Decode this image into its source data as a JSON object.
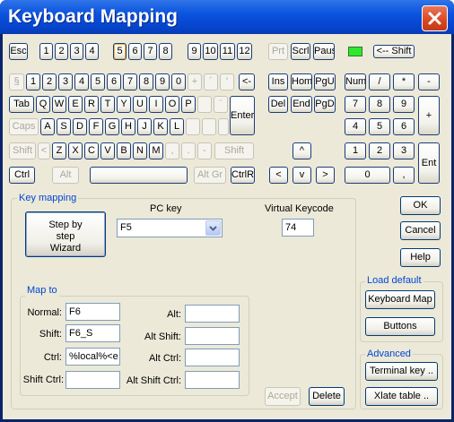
{
  "window": {
    "title": "Keyboard Mapping"
  },
  "keys": {
    "esc": "Esc",
    "f1": "1",
    "f2": "2",
    "f3": "3",
    "f4": "4",
    "f5": "5",
    "f6": "6",
    "f7": "7",
    "f8": "8",
    "f9": "9",
    "f10": "10",
    "f11": "11",
    "f12": "12",
    "prt": "Prt",
    "scrl": "Scrl",
    "paus": "Paus",
    "shift_toggle": "<-- Shift",
    "row1": [
      "§",
      "1",
      "2",
      "3",
      "4",
      "5",
      "6",
      "7",
      "8",
      "9",
      "0",
      "+",
      "´",
      "'",
      "<-"
    ],
    "row2": [
      "Tab",
      "Q",
      "W",
      "E",
      "R",
      "T",
      "Y",
      "U",
      "I",
      "O",
      "P",
      "",
      "¨",
      "Enter"
    ],
    "row3": [
      "Caps",
      "A",
      "S",
      "D",
      "F",
      "G",
      "H",
      "J",
      "K",
      "L",
      "",
      "",
      ""
    ],
    "row4": [
      "Shift",
      "<",
      "Z",
      "X",
      "C",
      "V",
      "B",
      "N",
      "M",
      ",",
      ".",
      "-",
      "Shift"
    ],
    "row5": [
      "Ctrl",
      "Alt",
      "",
      "Alt Gr",
      "CtrlR"
    ],
    "nav": {
      "ins": "Ins",
      "home": "Hom",
      "pgup": "PgU",
      "del": "Del",
      "end": "End",
      "pgdn": "PgD",
      "up": "^",
      "left": "<",
      "down": "v",
      "right": ">"
    },
    "numpad": {
      "num": "Num",
      "div": "/",
      "mul": "*",
      "sub": "-",
      "n7": "7",
      "n8": "8",
      "n9": "9",
      "add": "+",
      "n4": "4",
      "n5": "5",
      "n6": "6",
      "n1": "1",
      "n2": "2",
      "n3": "3",
      "ent": "Ent",
      "n0": "0",
      "dec": ","
    }
  },
  "key_mapping": {
    "group_label": "Key mapping",
    "wizard_label": [
      "Step by",
      "step",
      "Wizard"
    ],
    "pc_key_label": "PC key",
    "pc_key_value": "F5",
    "virtual_keycode_label": "Virtual Keycode",
    "virtual_keycode_value": "74"
  },
  "map_to": {
    "group_label": "Map to",
    "normal_label": "Normal:",
    "normal_value": "F6",
    "shift_label": "Shift:",
    "shift_value": "F6_S",
    "ctrl_label": "Ctrl:",
    "ctrl_value": "%local%<e",
    "shift_ctrl_label": "Shift Ctrl:",
    "shift_ctrl_value": "",
    "alt_label": "Alt:",
    "alt_value": "",
    "alt_shift_label": "Alt Shift:",
    "alt_shift_value": "",
    "alt_ctrl_label": "Alt Ctrl:",
    "alt_ctrl_value": "",
    "alt_shift_ctrl_label": "Alt Shift Ctrl:",
    "alt_shift_ctrl_value": ""
  },
  "buttons": {
    "ok": "OK",
    "cancel": "Cancel",
    "help": "Help",
    "accept": "Accept",
    "delete": "Delete"
  },
  "load_default": {
    "group_label": "Load default",
    "keyboard_map": "Keyboard Map",
    "buttons": "Buttons"
  },
  "advanced": {
    "group_label": "Advanced",
    "terminal_key": "Terminal key ..",
    "xlate_table": "Xlate table .."
  },
  "colors": {
    "title_bar": "#0b54de",
    "group_label": "#0046d5",
    "led": "#2ee82e",
    "close_button": "#d9471f"
  },
  "icons": {
    "close": "close-icon",
    "dropdown": "chevron-down-icon"
  }
}
